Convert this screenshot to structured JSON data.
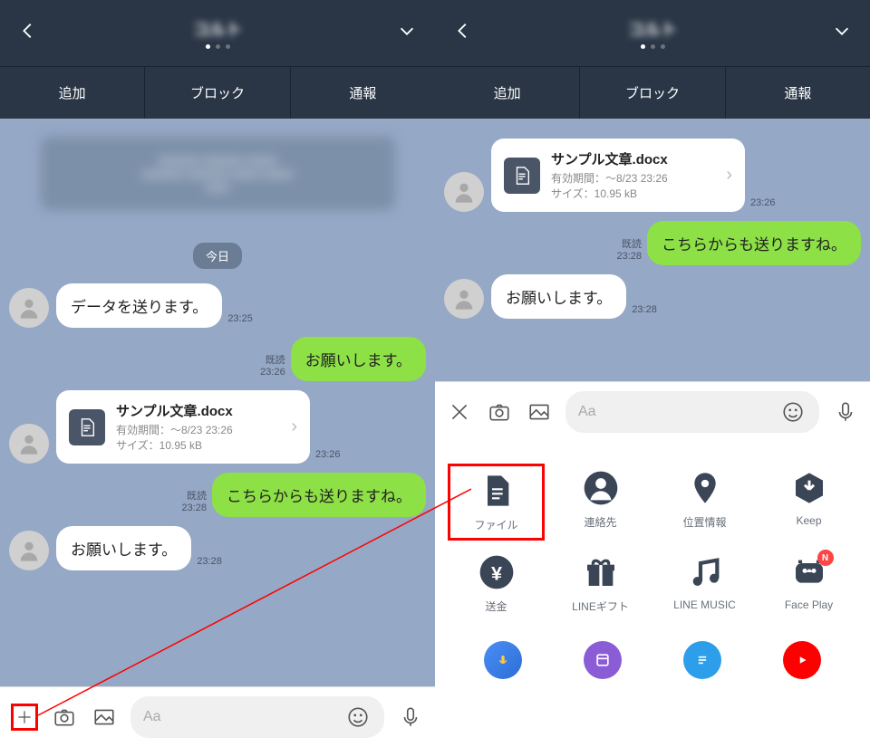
{
  "header": {
    "title": "コルト",
    "dots": 3
  },
  "actions": {
    "add": "追加",
    "block": "ブロック",
    "report": "通報"
  },
  "chat_left": {
    "date_label": "今日",
    "msg1": {
      "text": "データを送ります。",
      "time": "23:25"
    },
    "msg2": {
      "text": "お願いします。",
      "read": "既読",
      "time": "23:26"
    },
    "file": {
      "name": "サンプル文章.docx",
      "expiry": "有効期間：～8/23 23:26",
      "size": "サイズ：10.95 kB",
      "time": "23:26"
    },
    "msg3": {
      "text": "こちらからも送りますね。",
      "read": "既読",
      "time": "23:28"
    },
    "msg4": {
      "text": "お願いします。",
      "time": "23:28"
    }
  },
  "chat_right": {
    "file": {
      "name": "サンプル文章.docx",
      "expiry": "有効期間：～8/23 23:26",
      "size": "サイズ：10.95 kB",
      "time": "23:26"
    },
    "msg1": {
      "text": "こちらからも送りますね。",
      "read": "既読",
      "time": "23:28"
    },
    "msg2": {
      "text": "お願いします。",
      "time": "23:28"
    }
  },
  "input": {
    "placeholder": "Aa"
  },
  "attach": {
    "file": "ファイル",
    "contact": "連絡先",
    "location": "位置情報",
    "keep": "Keep",
    "money": "送金",
    "gift": "LINEギフト",
    "music": "LINE MUSIC",
    "faceplay": "Face Play",
    "badge": "N"
  }
}
